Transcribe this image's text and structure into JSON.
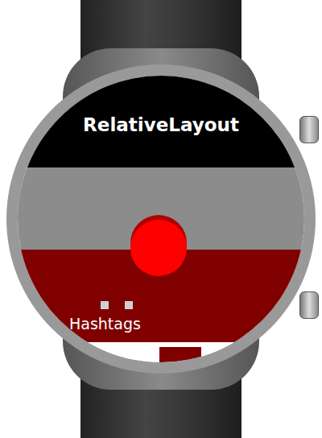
{
  "screen": {
    "title": "RelativeLayout",
    "label": "Hashtags"
  }
}
